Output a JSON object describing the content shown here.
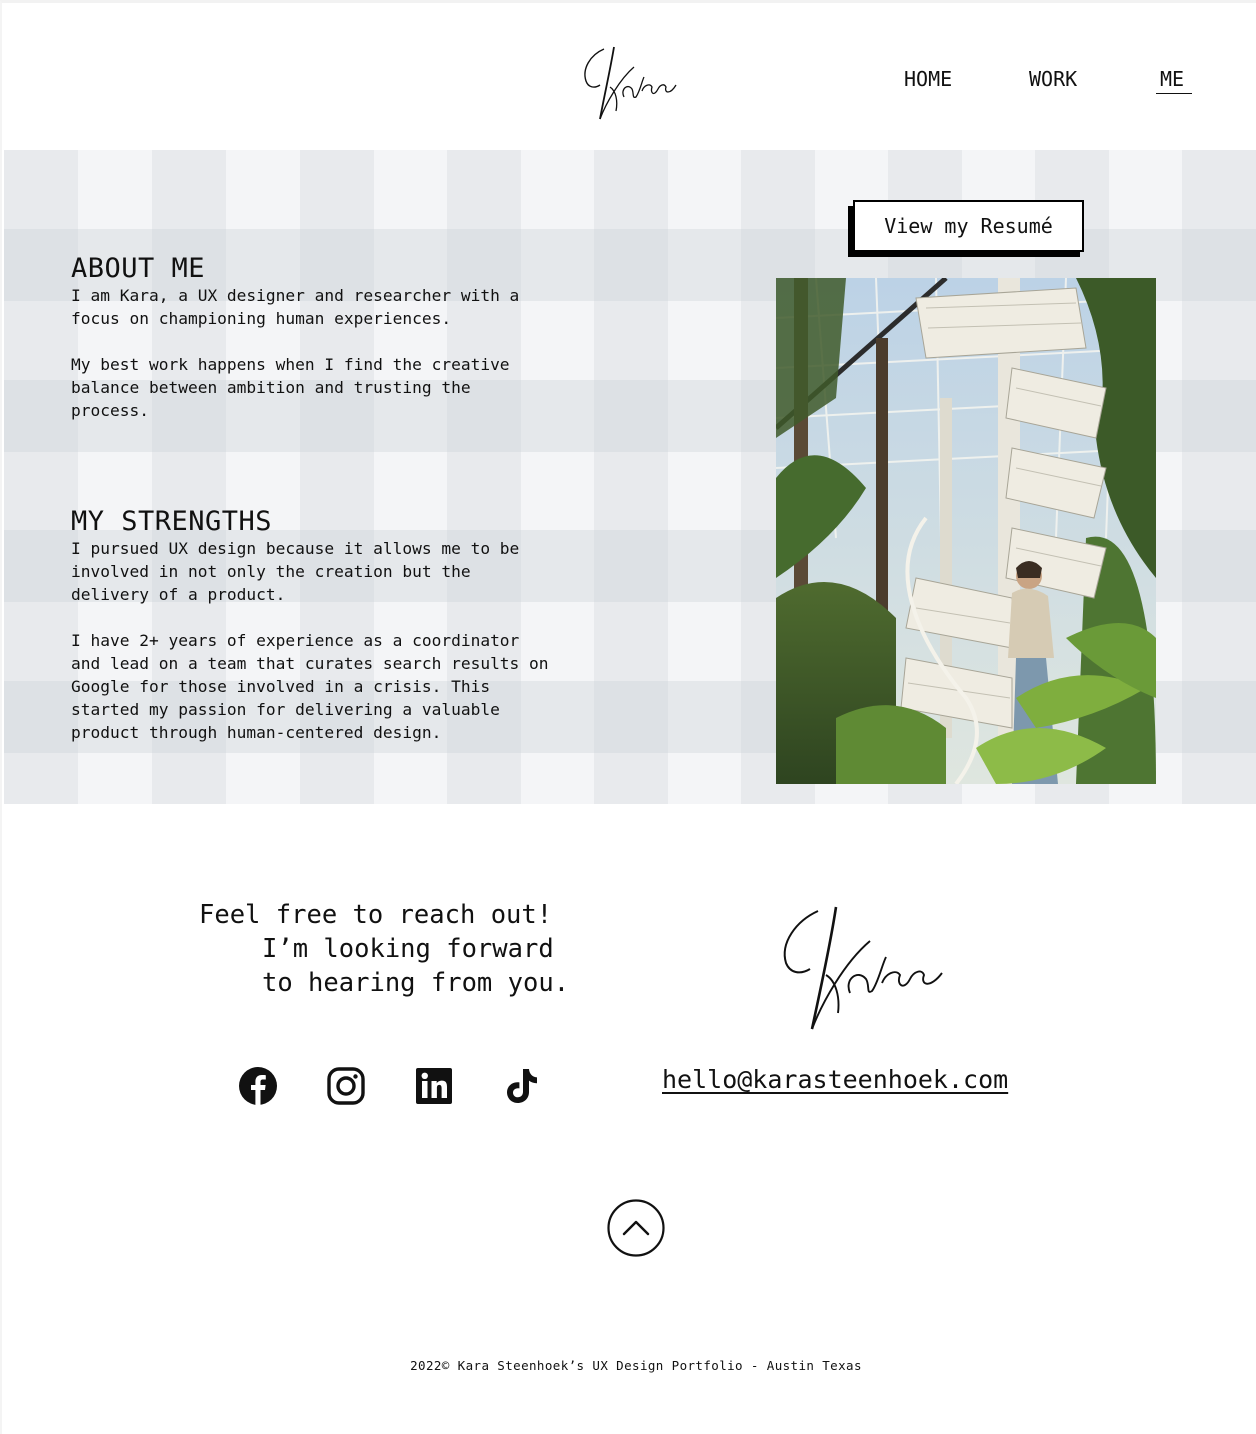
{
  "header": {
    "logo_text": "Kara",
    "nav": {
      "home": "HOME",
      "work": "WORK",
      "me": "ME"
    },
    "active_nav": "ME"
  },
  "about": {
    "title": "ABOUT ME",
    "paragraphs": [
      "I am Kara, a UX designer and researcher with a\nfocus on championing human experiences.",
      "My best work happens when I find the creative\nbalance between ambition and trusting the\nprocess."
    ]
  },
  "strengths": {
    "title": "MY STRENGTHS",
    "paragraphs": [
      "I pursued UX design because it allows me to be\ninvolved in not only the creation but the\ndelivery of a product.",
      "I have 2+ years of experience as a coordinator\nand lead on a team that curates search results on\nGoogle for those involved in a crisis. This\nstarted my passion for delivering a valuable\nproduct through human-centered design."
    ]
  },
  "resume_button": "View my Resumé",
  "photo": {
    "subject": "woman on white spiral staircase in greenhouse"
  },
  "footer": {
    "reach_out": {
      "line1": "Feel free to reach out!",
      "line2": "I’m looking forward",
      "line3": "to hearing from you."
    },
    "signature_text": "Kara",
    "email": "hello@karasteenhoek.com",
    "social_icons": [
      "facebook-icon",
      "instagram-icon",
      "linkedin-icon",
      "tiktok-icon"
    ],
    "back_to_top_icon": "chevron-up-icon",
    "copyright": "2022©  Kara Steenhoek’s UX Design Portfolio - Austin Texas"
  },
  "colors": {
    "text": "#111111",
    "plaid_base": "#f4f5f7",
    "plaid_stripe": "#dde1e6",
    "background": "#ffffff"
  }
}
